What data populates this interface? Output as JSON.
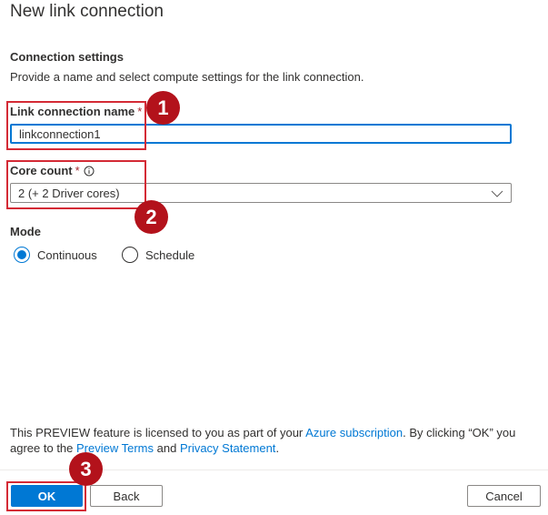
{
  "panel": {
    "title": "New link connection",
    "section_title": "Connection settings",
    "section_desc": "Provide a name and select compute settings for the link connection."
  },
  "form": {
    "name_label": "Link connection name",
    "name_required_mark": "*",
    "name_value": "linkconnection1",
    "core_label": "Core count",
    "core_required_mark": "*",
    "core_value": "2 (+ 2 Driver cores)",
    "mode_label": "Mode",
    "mode_options": [
      {
        "label": "Continuous",
        "selected": true
      },
      {
        "label": "Schedule",
        "selected": false
      }
    ]
  },
  "notice": {
    "part1": "This PREVIEW feature is licensed to you as part of your ",
    "link_azure": "Azure subscription",
    "part2": ". By clicking “OK” you agree to the ",
    "link_preview": "Preview Terms",
    "part3": " and ",
    "link_privacy": "Privacy Statement",
    "part4": "."
  },
  "buttons": {
    "ok": "OK",
    "back": "Back",
    "cancel": "Cancel"
  },
  "callouts": [
    "1",
    "2",
    "3"
  ],
  "colors": {
    "accent": "#0078d4",
    "highlight": "#d42a35",
    "callout": "#b3121b"
  },
  "icons": {
    "info": "info-icon",
    "dropdown": "chevron-down-icon"
  }
}
